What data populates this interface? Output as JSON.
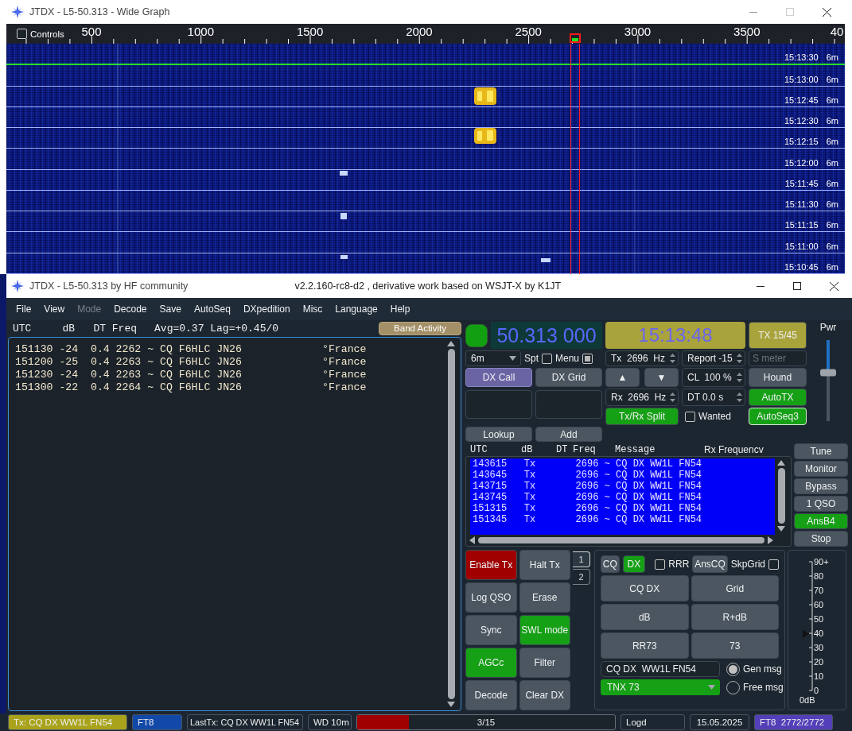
{
  "wide_graph": {
    "title": "JTDX - L5-50.313 - Wide Graph",
    "controls": {
      "label": "Controls",
      "checked": false
    },
    "scale_labels": [
      "500",
      "1000",
      "1500",
      "2000",
      "2500",
      "3000",
      "3500",
      "40"
    ],
    "rows": [
      {
        "time": "15:13:30",
        "band": "6m"
      },
      {
        "time": "15:13:00",
        "band": "6m"
      },
      {
        "time": "15:12:45",
        "band": "6m"
      },
      {
        "time": "15:12:30",
        "band": "6m"
      },
      {
        "time": "15:12:15",
        "band": "6m"
      },
      {
        "time": "15:12:00",
        "band": "6m"
      },
      {
        "time": "15:11:45",
        "band": "6m"
      },
      {
        "time": "15:11:30",
        "band": "6m"
      },
      {
        "time": "15:11:15",
        "band": "6m"
      },
      {
        "time": "15:11:00",
        "band": "6m"
      },
      {
        "time": "15:10:45",
        "band": "6m"
      }
    ]
  },
  "main_window": {
    "title": "JTDX - L5-50.313  by HF community",
    "version": "v2.2.160-rc8-d2 , derivative work based on WSJT-X by K1JT"
  },
  "menu": [
    {
      "label": "File",
      "disabled": false
    },
    {
      "label": "View",
      "disabled": false
    },
    {
      "label": "Mode",
      "disabled": true
    },
    {
      "label": "Decode",
      "disabled": false
    },
    {
      "label": "Save",
      "disabled": false
    },
    {
      "label": "AutoSeq",
      "disabled": false
    },
    {
      "label": "DXpedition",
      "disabled": false
    },
    {
      "label": "Misc",
      "disabled": false
    },
    {
      "label": "Language",
      "disabled": false
    },
    {
      "label": "Help",
      "disabled": false
    }
  ],
  "band_activity": {
    "header": "UTC     dB   DT Freq",
    "stats": "Avg=0.37 Lag=+0.45/0",
    "button": "Band Activity",
    "decodes": [
      {
        "text": "151130 -24  0.4 2262 ~ CQ F6HLC JN26",
        "country": "°France"
      },
      {
        "text": "151200 -25  0.4 2263 ~ CQ F6HLC JN26",
        "country": "°France"
      },
      {
        "text": "151230 -24  0.4 2263 ~ CQ F6HLC JN26",
        "country": "°France"
      },
      {
        "text": "151300 -22  0.4 2264 ~ CQ F6HLC JN26",
        "country": "°France"
      }
    ]
  },
  "station": {
    "monitor_on": true,
    "frequency": "50.313 000",
    "band": "6m",
    "spt": {
      "label": "Spt",
      "checked": false
    },
    "menu_toggle": {
      "label": "Menu",
      "checked": true
    },
    "dx_call": {
      "label": "DX Call",
      "selected": true
    },
    "dx_grid": {
      "label": "DX Grid",
      "selected": false
    },
    "lookup": "Lookup",
    "add": "Add"
  },
  "clock": "15:13:48",
  "tx_period": "TX 15/45",
  "spinners": {
    "tx": "Tx  2696  Hz",
    "report": "Report -15",
    "rx": "Rx  2696  Hz",
    "cl": "CL  100 %",
    "dt": "DT 0.0 s"
  },
  "s_meter": {
    "placeholder": "S meter"
  },
  "arrows": [
    "▲",
    "▼"
  ],
  "toggles": [
    {
      "label": "Hound",
      "on": false
    },
    {
      "label": "AutoTX",
      "on": true
    },
    {
      "label": "AutoSeq3",
      "on": true
    }
  ],
  "split": {
    "label": "Tx/Rx Split",
    "on": true
  },
  "wanted": {
    "label": "Wanted",
    "checked": false
  },
  "power": {
    "label": "Pwr",
    "level": 0.6
  },
  "tx_log": {
    "columns": [
      "UTC",
      "dB",
      "DT",
      "Freq",
      "Message",
      "Rx Frequencv"
    ],
    "rows": [
      "143615   Tx       2696 ~ CQ DX WW1L FN54",
      "143645   Tx       2696 ~ CQ DX WW1L FN54",
      "143715   Tx       2696 ~ CQ DX WW1L FN54",
      "143745   Tx       2696 ~ CQ DX WW1L FN54",
      "151315   Tx       2696 ~ CQ DX WW1L FN54",
      "151345   Tx       2696 ~ CQ DX WW1L FN54"
    ]
  },
  "side_buttons": [
    {
      "label": "Tune",
      "on": false
    },
    {
      "label": "Monitor",
      "on": false
    },
    {
      "label": "Bypass",
      "on": false
    },
    {
      "label": "1 QSO",
      "on": false
    },
    {
      "label": "AnsB4",
      "on": true
    },
    {
      "label": "Stop",
      "on": false
    }
  ],
  "action_buttons": [
    {
      "label": "Enable Tx",
      "kind": "tx",
      "on": true
    },
    {
      "label": "Halt Tx",
      "kind": "toggle",
      "on": false
    },
    {
      "label": "Log QSO",
      "kind": "toggle",
      "on": false
    },
    {
      "label": "Erase",
      "kind": "toggle",
      "on": false
    },
    {
      "label": "Sync",
      "kind": "toggle",
      "on": false
    },
    {
      "label": "SWL mode",
      "kind": "toggle",
      "on": true
    },
    {
      "label": "AGCc",
      "kind": "toggle",
      "on": true
    },
    {
      "label": "Filter",
      "kind": "toggle",
      "on": false
    },
    {
      "label": "Decode",
      "kind": "toggle",
      "on": false
    },
    {
      "label": "Clear DX",
      "kind": "toggle",
      "on": false
    }
  ],
  "tabs": [
    {
      "label": "1",
      "selected": true
    },
    {
      "label": "2",
      "selected": false
    }
  ],
  "messages": {
    "cq": {
      "label": "CQ",
      "on": false
    },
    "dx": {
      "label": "DX",
      "on": true
    },
    "rrr": {
      "label": "RRR",
      "checked": false
    },
    "ans_cq": {
      "label": "AnsCQ",
      "on": false
    },
    "skp_grid": {
      "label": "SkpGrid",
      "checked": false
    },
    "buttons": [
      "CQ DX",
      "Grid",
      "dB",
      "R+dB",
      "RR73",
      "73"
    ],
    "gen_msg": "CQ DX  WW1L FN54",
    "free_msg": "TNX 73",
    "modes": [
      {
        "label": "Gen msg",
        "selected": true
      },
      {
        "label": "Free msg",
        "selected": false
      }
    ]
  },
  "meter": {
    "ticks": [
      "90+",
      "80",
      "70",
      "60",
      "50",
      "40",
      "30",
      "20",
      "10",
      "0"
    ],
    "level": 0.44,
    "unit": "0dB"
  },
  "status_bar": {
    "tx": "Tx: CQ DX WW1L FN54",
    "mode": "FT8",
    "last_tx": "LastTx: CQ DX WW1L FN54",
    "wd": "WD 10m",
    "progress": {
      "level": 0.2,
      "text": "3/15"
    },
    "logd": "Logd",
    "date": "15.05.2025",
    "decoder": "FT8  2772/2772"
  }
}
